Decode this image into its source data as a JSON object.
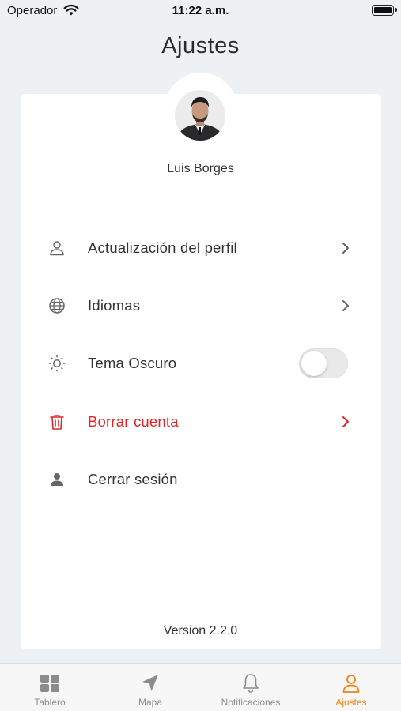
{
  "status_bar": {
    "carrier": "Operador",
    "time": "11:22 a.m."
  },
  "header": {
    "title": "Ajustes"
  },
  "profile": {
    "name": "Luis Borges"
  },
  "menu": {
    "items": [
      {
        "label": "Actualización del perfil",
        "icon": "user-outline-icon"
      },
      {
        "label": "Idiomas",
        "icon": "globe-icon"
      },
      {
        "label": "Tema Oscuro",
        "icon": "sun-icon",
        "toggle": false
      },
      {
        "label": "Borrar cuenta",
        "icon": "trash-icon",
        "color": "#e02424"
      },
      {
        "label": "Cerrar sesión",
        "icon": "user-solid-icon"
      }
    ]
  },
  "footer": {
    "version": "Version 2.2.0"
  },
  "tab_bar": {
    "tabs": [
      {
        "label": "Tablero",
        "icon": "grid-icon"
      },
      {
        "label": "Mapa",
        "icon": "navigation-arrow-icon"
      },
      {
        "label": "Notificaciones",
        "icon": "bell-icon"
      },
      {
        "label": "Ajustes",
        "icon": "user-outline-icon",
        "active": true
      }
    ],
    "active_color": "#f2820f",
    "inactive_color": "#8c8c8c"
  }
}
